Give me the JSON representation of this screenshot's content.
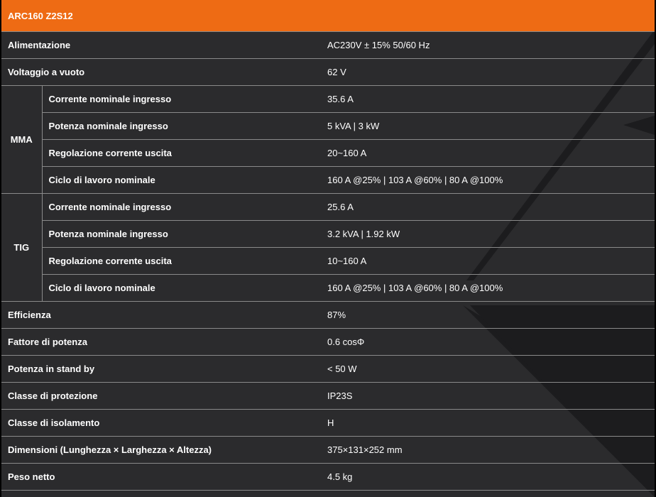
{
  "title": "ARC160 Z2S12",
  "rows_top": [
    {
      "label": "Alimentazione",
      "value": "AC230V ± 15% 50/60 Hz"
    },
    {
      "label": "Voltaggio a vuoto",
      "value": "62 V"
    }
  ],
  "groups": [
    {
      "name": "MMA",
      "rows": [
        {
          "label": "Corrente nominale ingresso",
          "value": "35.6 A"
        },
        {
          "label": "Potenza nominale ingresso",
          "value": "5 kVA | 3 kW"
        },
        {
          "label": "Regolazione corrente uscita",
          "value": "20~160 A"
        },
        {
          "label": "Ciclo di lavoro nominale",
          "value": "160 A @25% | 103 A @60% | 80 A @100%"
        }
      ]
    },
    {
      "name": "TIG",
      "rows": [
        {
          "label": "Corrente nominale ingresso",
          "value": "25.6 A"
        },
        {
          "label": "Potenza nominale ingresso",
          "value": "3.2 kVA | 1.92 kW"
        },
        {
          "label": "Regolazione corrente uscita",
          "value": "10~160 A"
        },
        {
          "label": "Ciclo di lavoro nominale",
          "value": "160 A @25% | 103 A @60% | 80 A @100%"
        }
      ]
    }
  ],
  "rows_bottom": [
    {
      "label": "Efficienza",
      "value": "87%"
    },
    {
      "label": "Fattore di potenza",
      "value": "0.6 cosΦ"
    },
    {
      "label": "Potenza in stand by",
      "value": "< 50 W"
    },
    {
      "label": "Classe di protezione",
      "value": "IP23S"
    },
    {
      "label": "Classe di isolamento",
      "value": "H"
    },
    {
      "label": "Dimensioni (Lunghezza × Larghezza × Altezza)",
      "value": "375×131×252 mm"
    },
    {
      "label": "Peso netto",
      "value": "4.5 kg"
    }
  ],
  "colors": {
    "header": "#ee6b14",
    "row_background": "#2b2b2d",
    "border": "#8a8a8a",
    "text": "#ffffff"
  }
}
